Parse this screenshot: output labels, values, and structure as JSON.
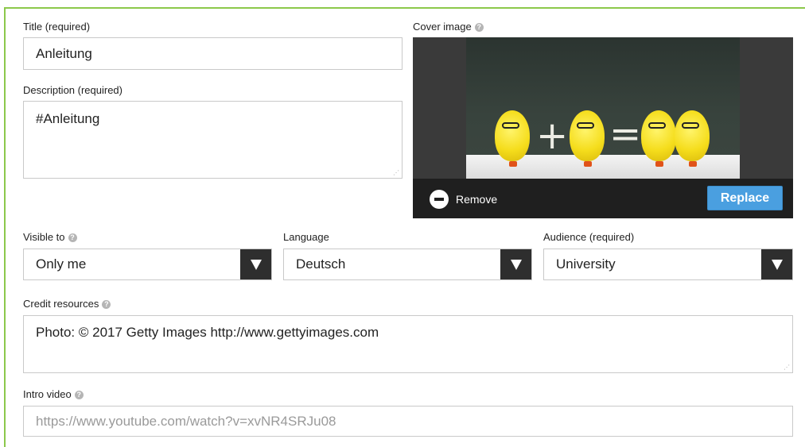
{
  "title_field": {
    "label": "Title (required)",
    "value": "Anleitung"
  },
  "description_field": {
    "label": "Description (required)",
    "value": "#Anleitung"
  },
  "cover": {
    "label": "Cover image",
    "remove_label": "Remove",
    "replace_label": "Replace",
    "image_alt_symbols": {
      "plus": "+",
      "equals": "="
    }
  },
  "visible_to": {
    "label": "Visible to",
    "value": "Only me"
  },
  "language": {
    "label": "Language",
    "value": "Deutsch"
  },
  "audience": {
    "label": "Audience (required)",
    "value": "University"
  },
  "credit": {
    "label": "Credit resources",
    "value": "Photo: © 2017 Getty Images http://www.gettyimages.com"
  },
  "intro_video": {
    "label": "Intro video",
    "placeholder": "https://www.youtube.com/watch?v=xvNR4SRJu08"
  },
  "help_glyph": "?",
  "colors": {
    "accent_border": "#8cc84b",
    "button_blue": "#4a9fe0",
    "select_dark": "#2e2e2e"
  }
}
